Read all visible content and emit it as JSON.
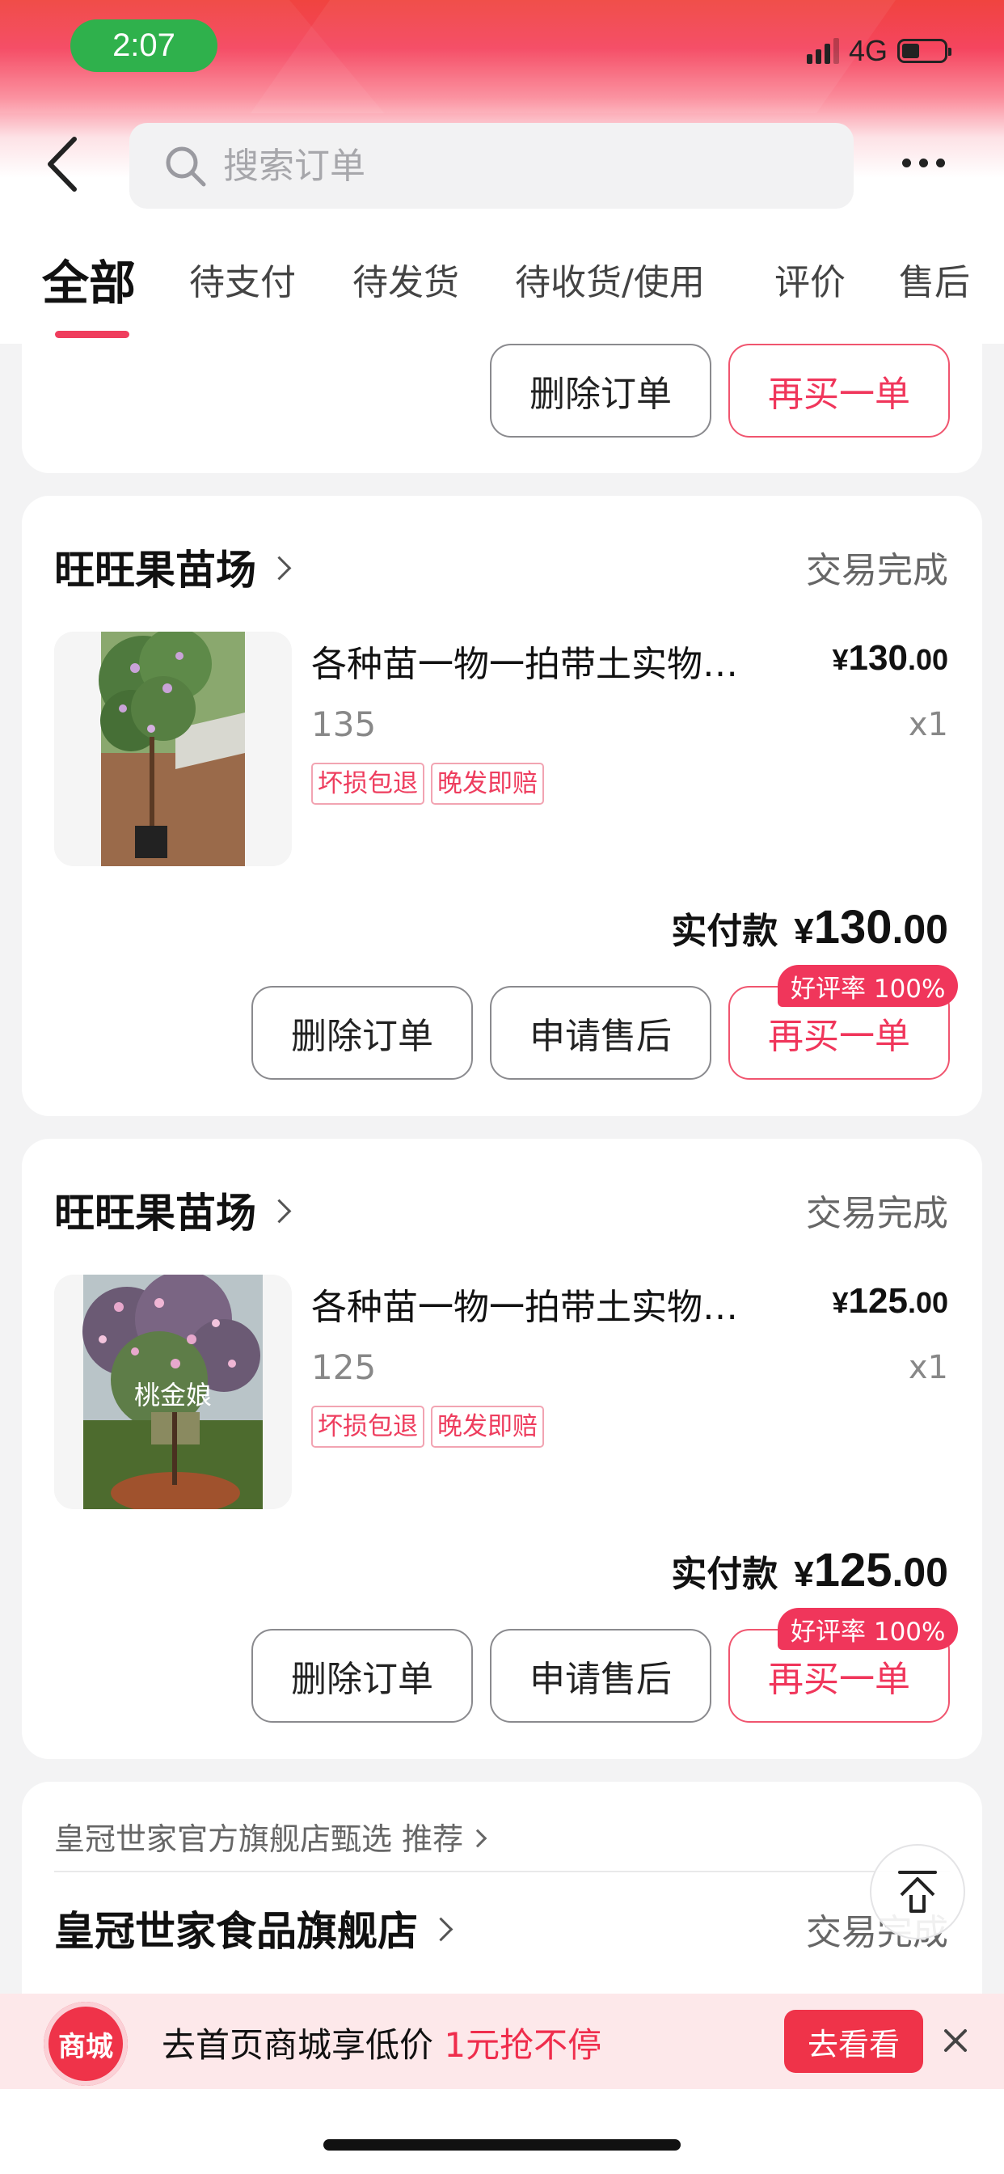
{
  "status_bar": {
    "time": "2:07",
    "network": "4G"
  },
  "header": {
    "search_placeholder": "搜索订单",
    "tabs": [
      {
        "label": "全部",
        "active": true
      },
      {
        "label": "待支付"
      },
      {
        "label": "待发货"
      },
      {
        "label": "待收货/使用"
      },
      {
        "label": "评价"
      },
      {
        "label": "售后"
      }
    ]
  },
  "top_card": {
    "delete_label": "删除订单",
    "rebuy_label": "再买一单"
  },
  "orders": [
    {
      "shop": "旺旺果苗场",
      "status": "交易完成",
      "title": "各种苗一物一拍带土实物拍摄发货",
      "price_symbol": "¥",
      "price_int": "130",
      "price_dec": ".00",
      "spec": "135",
      "qty": "x1",
      "tags": [
        "坏损包退",
        "晚发即赔"
      ],
      "paid_label": "实付款",
      "paid_int": "130",
      "paid_dec": ".00",
      "buttons": {
        "delete": "删除订单",
        "after_sale": "申请售后",
        "rebuy": "再买一单"
      },
      "badge": "好评率 100%"
    },
    {
      "shop": "旺旺果苗场",
      "status": "交易完成",
      "title": "各种苗一物一拍带土实物拍摄发货",
      "price_symbol": "¥",
      "price_int": "125",
      "price_dec": ".00",
      "spec": "125",
      "qty": "x1",
      "tags": [
        "坏损包退",
        "晚发即赔"
      ],
      "image_caption": "桃金娘",
      "paid_label": "实付款",
      "paid_int": "125",
      "paid_dec": ".00",
      "buttons": {
        "delete": "删除订单",
        "after_sale": "申请售后",
        "rebuy": "再买一单"
      },
      "badge": "好评率 100%"
    }
  ],
  "recommend_card": {
    "line": "皇冠世家官方旗舰店甄选 推荐",
    "shop": "皇冠世家食品旗舰店",
    "status": "交易完成"
  },
  "promo": {
    "logo": "商城",
    "text": "去首页商城享低价 ",
    "highlight": "1元抢不停",
    "button": "去看看"
  },
  "colors": {
    "accent": "#ef3d5d",
    "status_pill": "#2fb14c"
  }
}
